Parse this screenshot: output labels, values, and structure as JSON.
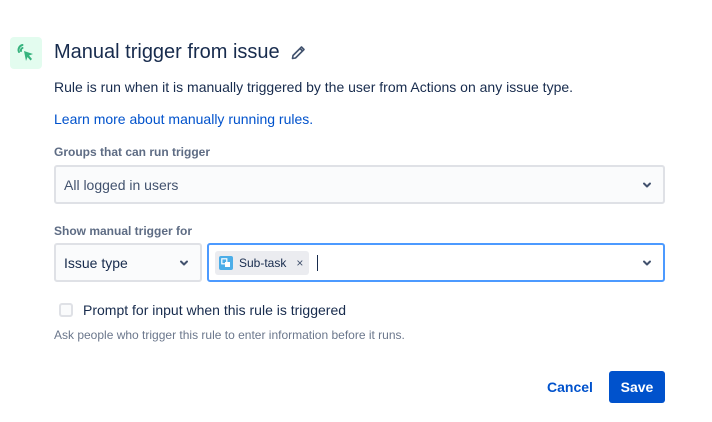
{
  "header": {
    "trigger_icon": "cursor-click-icon",
    "title": "Manual trigger from issue",
    "edit_icon": "pencil-icon"
  },
  "description": "Rule is run when it is manually triggered by the user from Actions on any issue type.",
  "learn_more_link": "Learn more about manually running rules.",
  "groups_field": {
    "label": "Groups that can run trigger",
    "value": "All logged in users"
  },
  "show_trigger_field": {
    "label": "Show manual trigger for",
    "type_select_value": "Issue type",
    "selected_tags": [
      {
        "label": "Sub-task",
        "icon": "subtask-icon",
        "remove_glyph": "×"
      }
    ]
  },
  "prompt_checkbox": {
    "label": "Prompt for input when this rule is triggered",
    "checked": false,
    "helper": "Ask people who trigger this rule to enter information before it runs."
  },
  "actions": {
    "cancel_label": "Cancel",
    "save_label": "Save"
  },
  "colors": {
    "accent": "#0052cc",
    "icon_bg": "#e3fcef",
    "icon_green": "#36b37e",
    "focus_border": "#4c9aff",
    "subtask_blue": "#4bade8"
  }
}
